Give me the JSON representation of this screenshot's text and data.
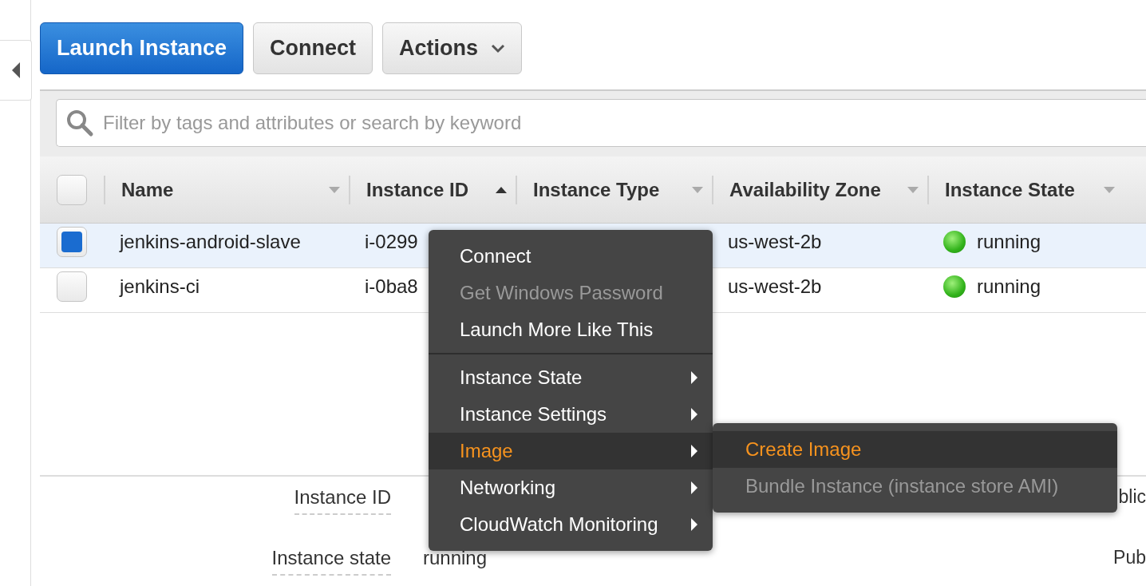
{
  "toolbar": {
    "buttons": [
      {
        "label": "Launch Instance",
        "kind": "primary"
      },
      {
        "label": "Connect",
        "kind": "plain"
      },
      {
        "label": "Actions",
        "kind": "dropdown"
      }
    ]
  },
  "search": {
    "placeholder": "Filter by tags and attributes or search by keyword"
  },
  "table": {
    "select_all": {
      "checked": false
    },
    "columns": [
      {
        "label": "Name",
        "sorted": false
      },
      {
        "label": "Instance ID",
        "sorted": true
      },
      {
        "label": "Instance Type",
        "sorted": false
      },
      {
        "label": "Availability Zone",
        "sorted": false
      },
      {
        "label": "Instance State",
        "sorted": false
      }
    ],
    "rows": [
      {
        "selected": true,
        "checked": true,
        "name": "jenkins-android-slave",
        "id": "i-0299",
        "zone": "us-west-2b",
        "state": "running"
      },
      {
        "selected": false,
        "checked": false,
        "name": "jenkins-ci",
        "id": "i-0ba8",
        "zone": "us-west-2b",
        "state": "running"
      }
    ]
  },
  "details": [
    {
      "label": "Instance ID",
      "right_label": "blic"
    },
    {
      "label": "Instance state",
      "value": "running",
      "right_label": "Pub"
    }
  ],
  "context_menu": {
    "groups": [
      [
        {
          "label": "Connect",
          "disabled": false,
          "selected": false,
          "submenu": false
        },
        {
          "label": "Get Windows Password",
          "disabled": true,
          "selected": false,
          "submenu": false
        },
        {
          "label": "Launch More Like This",
          "disabled": false,
          "selected": false,
          "submenu": false
        }
      ],
      [
        {
          "label": "Instance State",
          "disabled": false,
          "selected": false,
          "submenu": true
        },
        {
          "label": "Instance Settings",
          "disabled": false,
          "selected": false,
          "submenu": true
        },
        {
          "label": "Image",
          "disabled": false,
          "selected": true,
          "submenu": true
        },
        {
          "label": "Networking",
          "disabled": false,
          "selected": false,
          "submenu": true
        },
        {
          "label": "CloudWatch Monitoring",
          "disabled": false,
          "selected": false,
          "submenu": true
        }
      ]
    ],
    "submenu": [
      {
        "label": "Create Image",
        "disabled": false,
        "selected": true
      },
      {
        "label": "Bundle Instance (instance store AMI)",
        "disabled": true,
        "selected": false
      }
    ]
  }
}
